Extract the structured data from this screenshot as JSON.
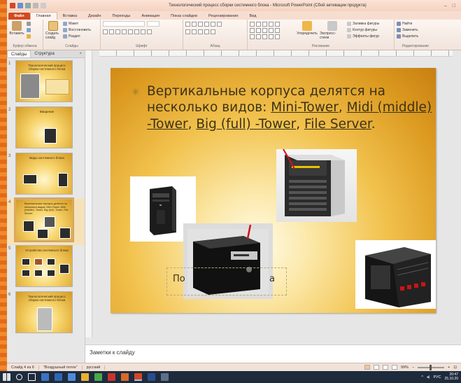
{
  "window": {
    "title": "Технологический процесс сборки системного блока - Microsoft PowerPoint (Сбой активации продукта)"
  },
  "ribbon_tabs": [
    "Файл",
    "Главная",
    "Вставка",
    "Дизайн",
    "Переходы",
    "Анимация",
    "Показ слайдов",
    "Рецензирование",
    "Вид"
  ],
  "ribbon": {
    "clipboard": {
      "paste": "Вставить",
      "label": "Буфер обмена"
    },
    "slides": {
      "new_slide": "Создать слайд",
      "layout": "Макет",
      "reset": "Восстановить",
      "section": "Раздел",
      "label": "Слайды"
    },
    "font": {
      "label": "Шрифт"
    },
    "paragraph": {
      "label": "Абзац"
    },
    "drawing": {
      "arrange": "Упорядочить",
      "quick_styles": "Экспресс-стили",
      "fill": "Заливка фигуры",
      "outline": "Контур фигуры",
      "effects": "Эффекты фигур",
      "label": "Рисование"
    },
    "editing": {
      "find": "Найти",
      "replace": "Заменить",
      "select": "Выделить",
      "label": "Редактирование"
    }
  },
  "slides_pane": {
    "tabs": [
      "Слайды",
      "Структура"
    ],
    "close": "×",
    "thumbnails": [
      {
        "num": "1",
        "title": "Технологический процесс сборки системного блока"
      },
      {
        "num": "2",
        "title": "Введение"
      },
      {
        "num": "3",
        "title": "Виды системного блока"
      },
      {
        "num": "4",
        "title": "Вертикальные корпуса делятся на несколько видов: Mini-Tower, Midi (middle) -Tower, Big (full) -Tower, File Server."
      },
      {
        "num": "5",
        "title": "Устройства системного блока"
      },
      {
        "num": "6",
        "title": "Технологический процесс сборки системного блока"
      }
    ]
  },
  "slide": {
    "bullet": "✳",
    "title_prefix": "Вертикальные корпуса делятся на несколько видов: ",
    "mini": "Mini-Tower",
    "sep1": ", ",
    "midi": "Midi (middle) -Tower",
    "sep2": ", ",
    "big": "Big (full) -Tower",
    "sep3": ", ",
    "file": "File Server",
    "end": ".",
    "textbox_left": "По",
    "textbox_right": "а"
  },
  "notes": {
    "placeholder": "Заметки к слайду"
  },
  "statusbar": {
    "slide": "Слайд 4 из 6",
    "theme": "\"Воздушный поток\"",
    "language": "русский",
    "zoom": "99%"
  },
  "taskbar": {
    "language": "РУС",
    "time": "20:47",
    "date": "25.10.20"
  },
  "colors": {
    "accent": "#d04a1f",
    "slide_bg": "#f2c34f"
  }
}
